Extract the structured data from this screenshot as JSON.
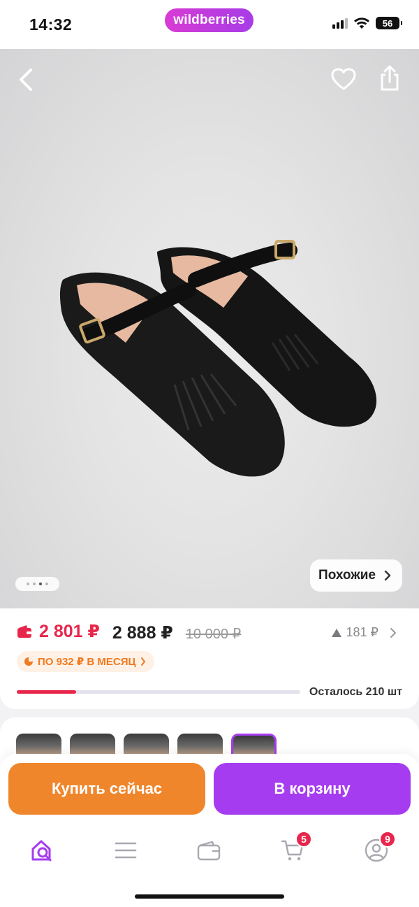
{
  "status_bar": {
    "time": "14:32",
    "brand": "wildberries",
    "battery": "56"
  },
  "hero": {
    "similar_label": "Похожие",
    "photo_count": 4,
    "active_photo": 2
  },
  "price": {
    "wallet_price": "2 801 ₽",
    "card_price": "2 888 ₽",
    "old_price": "10 000 ₽",
    "rise": "181 ₽",
    "installment": "ПО 932 ₽ В МЕСЯЦ",
    "stock_text": "Осталось 210 шт",
    "stock_level": 0.21
  },
  "thumbs": {
    "count": 5,
    "selected_index": 4
  },
  "actions": {
    "buy_label": "Купить сейчас",
    "cart_label": "В корзину"
  },
  "tab_bar": {
    "items": [
      {
        "name": "search",
        "icon": "home-search-icon",
        "active": true
      },
      {
        "name": "catalog",
        "icon": "menu-icon"
      },
      {
        "name": "wallet",
        "icon": "wallet-icon"
      },
      {
        "name": "cart",
        "icon": "cart-icon",
        "badge": "5"
      },
      {
        "name": "profile",
        "icon": "profile-icon",
        "badge": "9"
      }
    ]
  },
  "colors": {
    "brand_purple": "#a63cf0",
    "buy_orange": "#f0862c",
    "price_red": "#e8264b",
    "installment_orange": "#f07a1f"
  }
}
